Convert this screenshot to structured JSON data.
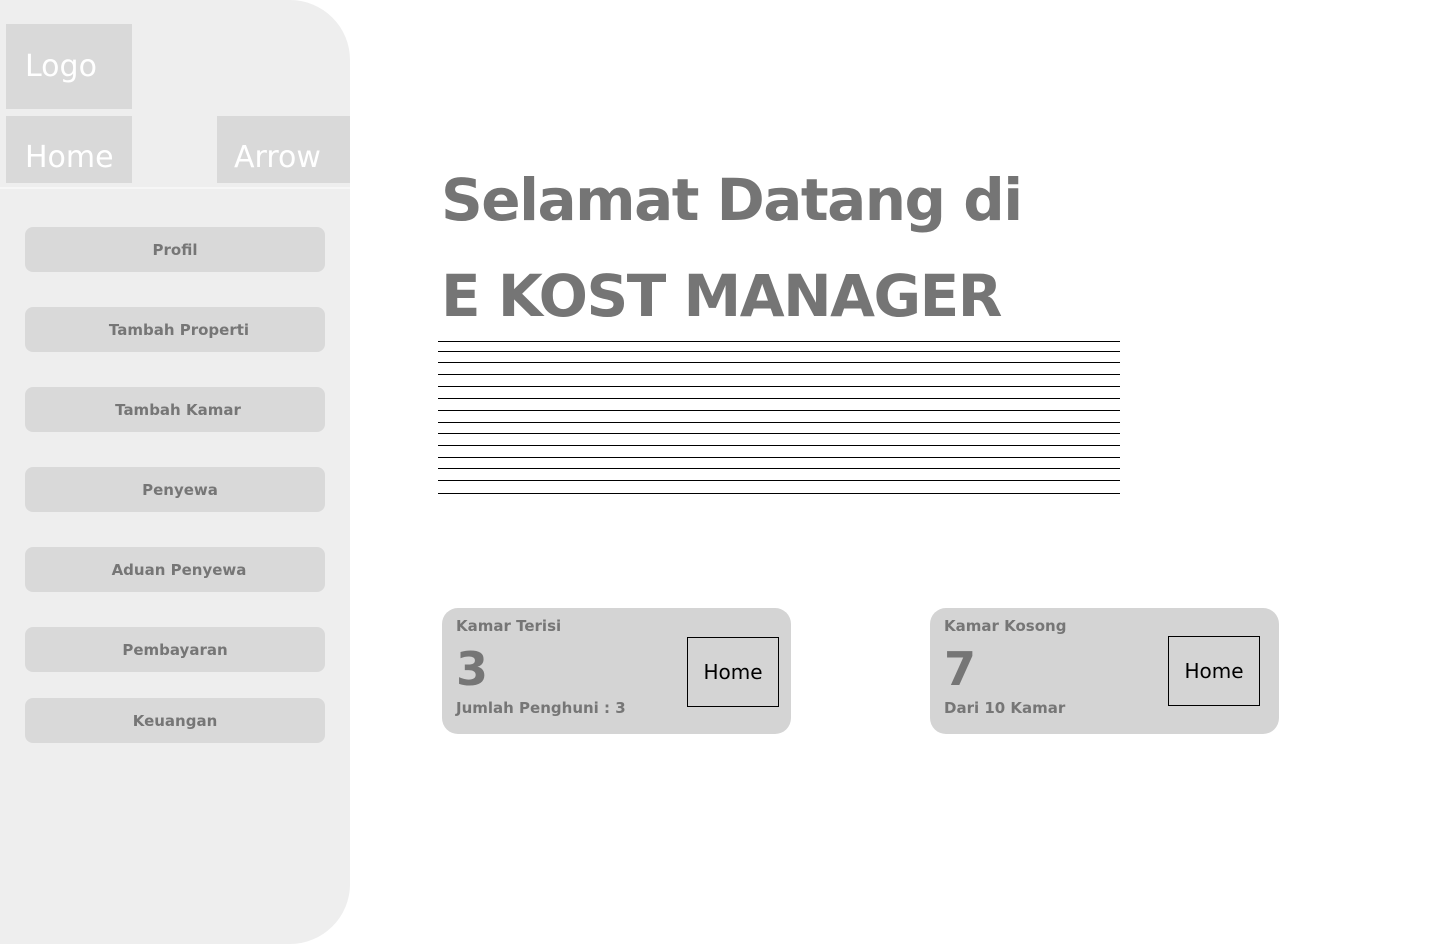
{
  "sidebar": {
    "logo": "Logo",
    "home": "Home",
    "arrow": "Arrow",
    "menu": [
      {
        "label": "Profil"
      },
      {
        "label": "Tambah Properti"
      },
      {
        "label": "Tambah Kamar"
      },
      {
        "label": "Penyewa"
      },
      {
        "label": "Aduan Penyewa"
      },
      {
        "label": "Pembayaran"
      },
      {
        "label": "Keuangan"
      }
    ]
  },
  "main": {
    "welcome_line1": "Selamat Datang di",
    "welcome_line2": "E KOST MANAGER",
    "cards": [
      {
        "title": "Kamar Terisi",
        "value": "3",
        "subtitle": "Jumlah Penghuni : 3",
        "button_label": "Home"
      },
      {
        "title": "Kamar Kosong",
        "value": "7",
        "subtitle": "Dari 10 Kamar",
        "button_label": "Home"
      }
    ]
  }
}
